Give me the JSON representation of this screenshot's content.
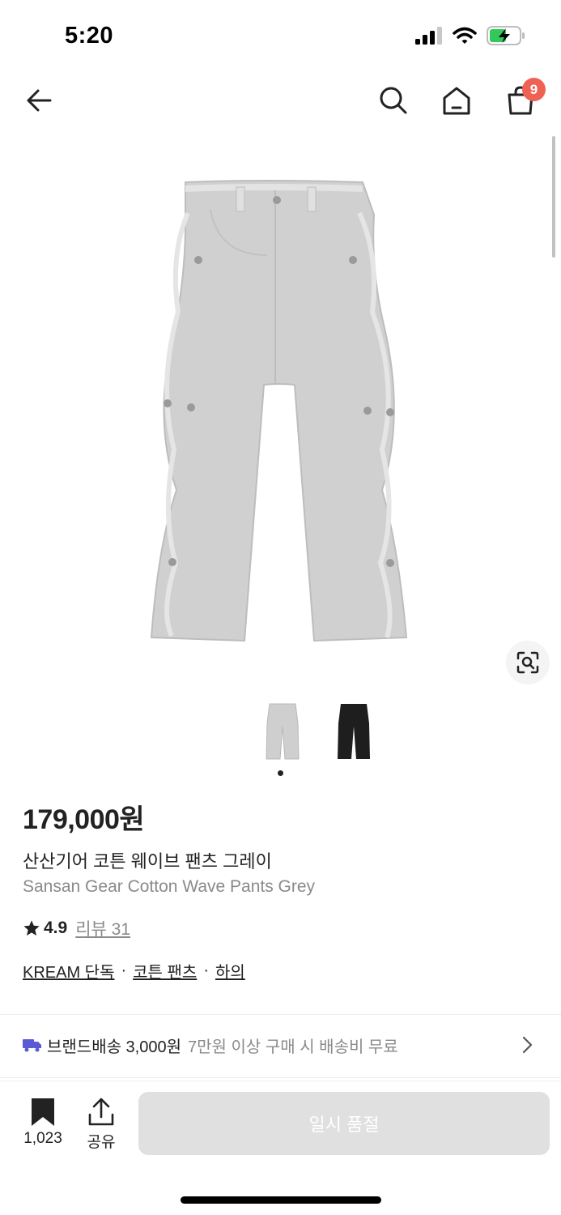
{
  "status_bar": {
    "time": "5:20"
  },
  "header": {
    "cart_count": "9"
  },
  "product": {
    "price": "179,000원",
    "title_ko": "산산기어 코튼 웨이브 팬츠 그레이",
    "title_en": "Sansan Gear Cotton Wave Pants Grey",
    "rating": "4.9",
    "review_label": "리뷰 31",
    "tags": [
      "KREAM 단독",
      "코튼 팬츠",
      "하의"
    ],
    "tag_separator": "·"
  },
  "shipping": {
    "label": "브랜드배송 3,000원",
    "note": "7만원 이상 구매 시 배송비 무료"
  },
  "bottom": {
    "bookmark_count": "1,023",
    "share_label": "공유",
    "buy_label": "일시 품절"
  },
  "icons": {
    "back": "arrow-left-icon",
    "search": "search-icon",
    "home": "home-icon",
    "cart": "shopping-bag-icon",
    "lens": "image-search-icon",
    "truck": "truck-icon",
    "chevron": "chevron-right-icon",
    "bookmark": "bookmark-icon",
    "share": "share-icon",
    "star": "star-icon"
  },
  "colors": {
    "badge": "#ef6253",
    "truck_icon": "#5a5ad6",
    "sold_out_button": "#e0e0e0",
    "muted_text": "#8a8a8a"
  }
}
